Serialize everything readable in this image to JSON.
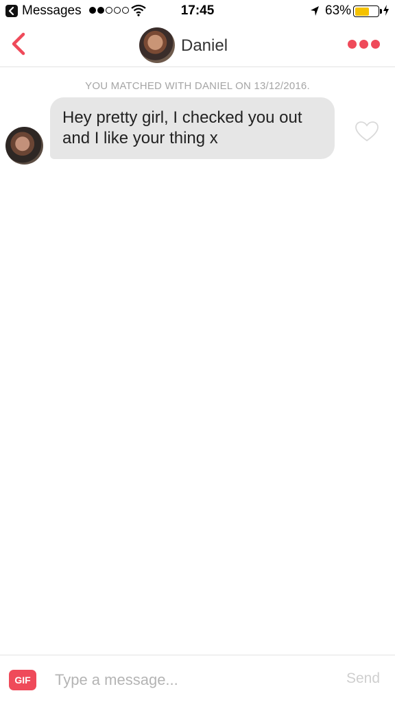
{
  "status_bar": {
    "back_app": "Messages",
    "time": "17:45",
    "battery_percent": "63%",
    "battery_level": 0.63,
    "battery_color": "#f5c200",
    "signal_bars": 2,
    "signal_total": 5,
    "icons": [
      "back-arrow-icon",
      "signal-dots-icon",
      "wifi-icon",
      "location-arrow-icon",
      "battery-icon",
      "charging-bolt-icon"
    ]
  },
  "nav": {
    "name": "Daniel",
    "back_icon": "chevron-left-icon",
    "more_icon": "more-dots-icon",
    "accent": "#ef4a5a"
  },
  "conversation": {
    "match_notice": "YOU MATCHED WITH DANIEL ON 13/12/2016.",
    "messages": [
      {
        "text": "Hey pretty girl, I checked you out and I like your thing x",
        "liked": false
      }
    ]
  },
  "input_bar": {
    "gif_label": "GIF",
    "placeholder": "Type a message...",
    "value": "",
    "send_label": "Send"
  }
}
